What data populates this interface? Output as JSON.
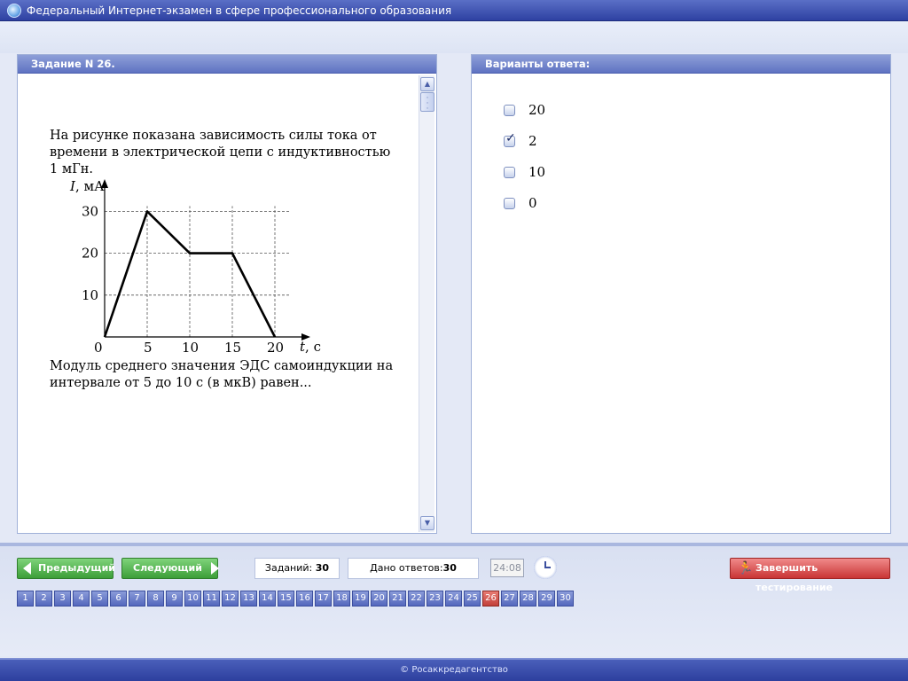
{
  "window": {
    "title": "Федеральный Интернет-экзамен в сфере профессионального образования"
  },
  "task_panel": {
    "header": "Задание N 26.",
    "question_intro": "На рисунке показана зависимость силы тока от времени в электрической цепи с индуктивностью 1 мГн.",
    "question_ask": "Модуль среднего значения ЭДС самоиндукции на интервале от 5 до 10 с (в мкВ) равен..."
  },
  "chart_data": {
    "type": "line",
    "ylabel_var": "I",
    "ylabel_unit": ", мА",
    "xlabel_var": "t",
    "xlabel_unit": ", с",
    "x_ticks": [
      "0",
      "5",
      "10",
      "15",
      "20"
    ],
    "y_ticks": [
      "10",
      "20",
      "30"
    ],
    "xlim": [
      0,
      20
    ],
    "ylim": [
      0,
      30
    ],
    "grid": true,
    "x": [
      0,
      5,
      10,
      15,
      20
    ],
    "y": [
      0,
      30,
      20,
      20,
      0
    ]
  },
  "answers_panel": {
    "header": "Варианты ответа:",
    "options": [
      {
        "label": "20",
        "checked": false
      },
      {
        "label": "2",
        "checked": true
      },
      {
        "label": "10",
        "checked": false
      },
      {
        "label": "0",
        "checked": false
      }
    ]
  },
  "navigation": {
    "prev_label": "Предыдущий",
    "next_label": "Следующий",
    "tasks_label": "Заданий:",
    "tasks_count": "30",
    "answered_label": "Дано ответов:",
    "answered_count": "30",
    "timer": "24:08",
    "finish_label": "Завершить тестирование",
    "current_page": 26,
    "pages": [
      "1",
      "2",
      "3",
      "4",
      "5",
      "6",
      "7",
      "8",
      "9",
      "10",
      "11",
      "12",
      "13",
      "14",
      "15",
      "16",
      "17",
      "18",
      "19",
      "20",
      "21",
      "22",
      "23",
      "24",
      "25",
      "26",
      "27",
      "28",
      "29",
      "30"
    ]
  },
  "footer": {
    "text": "© Росаккредагентство"
  },
  "icons": {
    "app": "app-globe-icon",
    "clock": "clock-icon",
    "finish": "runner-icon",
    "check": "check-icon"
  }
}
